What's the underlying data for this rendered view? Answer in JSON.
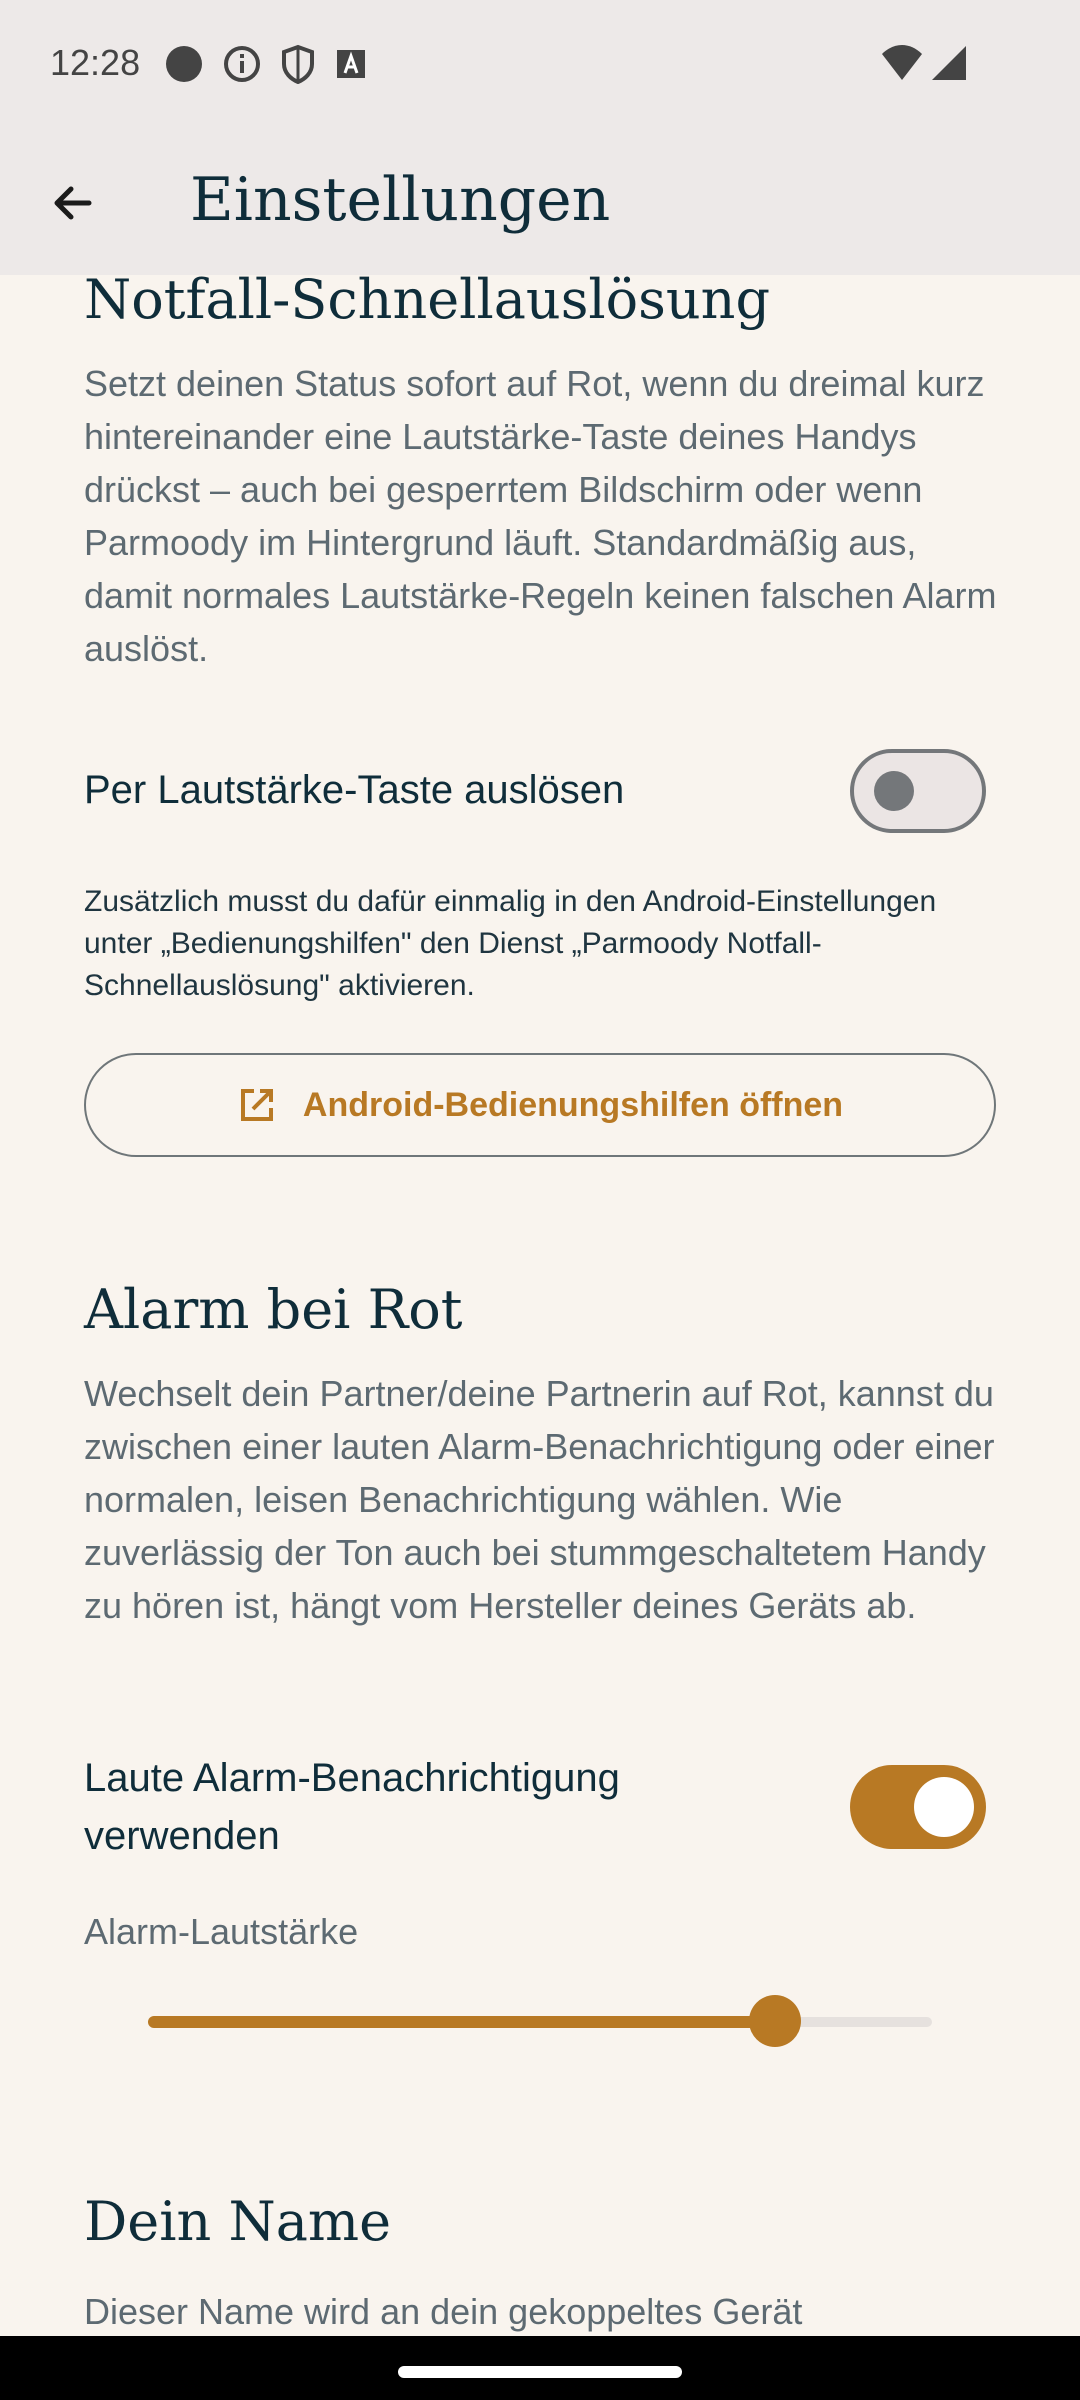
{
  "status_bar": {
    "time": "12:28",
    "left_icons": [
      "record-dot-icon",
      "info-icon",
      "shield-icon",
      "keyboard-a-icon"
    ],
    "right_icons": [
      "wifi-icon",
      "cell-signal-icon"
    ]
  },
  "app_bar": {
    "title": "Einstellungen",
    "back_icon": "arrow-left-icon"
  },
  "emergency": {
    "title": "Notfall-Schnellauslösung",
    "description": "Setzt deinen Status sofort auf Rot, wenn du dreimal kurz hintereinander eine Lautstärke-Taste deines Handys drückst – auch bei gesperrtem Bildschirm oder wenn Parmoody im Hintergrund läuft. Standardmäßig aus, damit normales Lautstärke-Regeln keinen falschen Alarm auslöst.",
    "toggle_label": "Per Lautstärke-Taste auslösen",
    "toggle_on": false,
    "hint": "Zusätzlich musst du dafür einmalig in den Android-Einstellungen unter „Bedienungshilfen\" den Dienst „Parmoody Notfall-Schnellauslösung\" aktivieren.",
    "button_label": "Android-Bedienungshilfen öffnen",
    "button_icon": "open-external-icon"
  },
  "alarm": {
    "title": "Alarm bei Rot",
    "description": "Wechselt dein Partner/deine Partnerin auf Rot, kannst du zwischen einer lauten Alarm-Benachrichtigung oder einer normalen, leisen Benachrichtigung wählen. Wie zuverlässig der Ton auch bei stummgeschaltetem Handy zu hören ist, hängt vom Hersteller deines Geräts ab.",
    "toggle_label": "Laute Alarm-Benachrichtigung verwenden",
    "toggle_on": true,
    "volume_label": "Alarm-Lautstärke",
    "volume_fraction": 0.8
  },
  "name": {
    "title": "Dein Name",
    "description": "Dieser Name wird an dein gekoppeltes Gerät"
  },
  "colors": {
    "accent": "#b87924",
    "background": "#f9f4ee",
    "app_bar": "#ede9e8",
    "text_dark": "#0f2d3a",
    "text_muted": "#5d6a72"
  }
}
